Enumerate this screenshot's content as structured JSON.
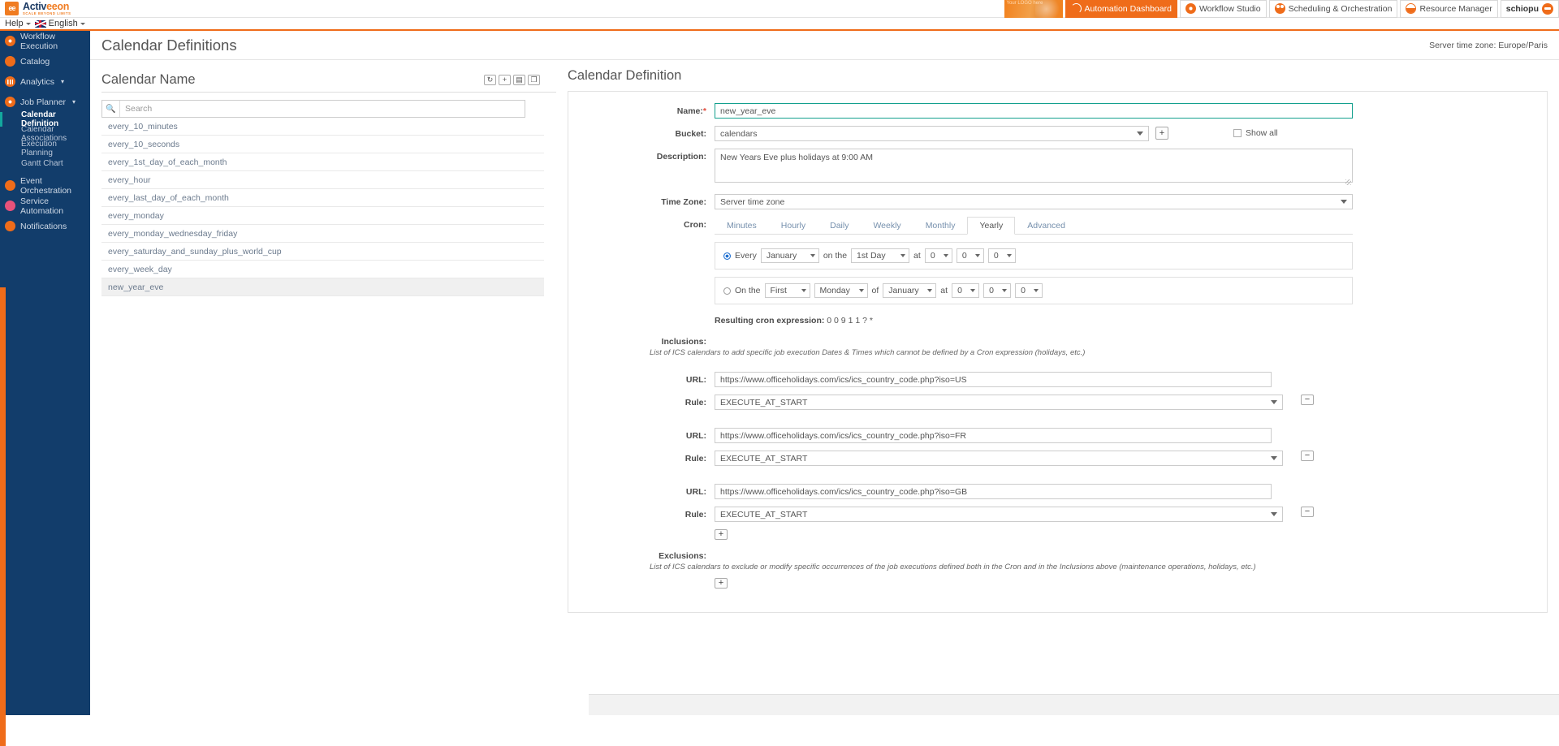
{
  "brand": {
    "name_part1": "Activ",
    "name_part2": "eeon",
    "tagline": "SCALE BEYOND LIMITS",
    "mark": "ee"
  },
  "topnav": {
    "logo_placeholder": "Your\nLOGO\nhere",
    "items": [
      {
        "label": "Automation Dashboard",
        "icon": "gauge-icon",
        "active": true
      },
      {
        "label": "Workflow Studio",
        "icon": "workflow-icon",
        "active": false
      },
      {
        "label": "Scheduling & Orchestration",
        "icon": "gears-icon",
        "active": false
      },
      {
        "label": "Resource Manager",
        "icon": "resource-icon",
        "active": false
      }
    ],
    "user": "schiopu"
  },
  "helpbar": {
    "help": "Help",
    "language": "English"
  },
  "sidebar": {
    "items": [
      {
        "label": "Workflow Execution",
        "icon": "play-circle-icon",
        "expandable": false
      },
      {
        "label": "Catalog",
        "icon": "catalog-icon",
        "expandable": false
      },
      {
        "label": "Analytics",
        "icon": "analytics-icon",
        "expandable": true
      },
      {
        "label": "Job Planner",
        "icon": "clock-icon",
        "expandable": true
      }
    ],
    "subitems": [
      {
        "label": "Calendar Definition",
        "active": true
      },
      {
        "label": "Calendar Associations",
        "active": false
      },
      {
        "label": "Execution Planning",
        "active": false
      },
      {
        "label": "Gantt Chart",
        "active": false
      }
    ],
    "items_after": [
      {
        "label": "Event Orchestration",
        "icon": "event-icon",
        "expandable": false
      },
      {
        "label": "Service Automation",
        "icon": "service-icon",
        "expandable": false
      },
      {
        "label": "Notifications",
        "icon": "bell-icon",
        "expandable": false
      }
    ]
  },
  "page": {
    "title": "Calendar Definitions",
    "server_timezone": "Server time zone: Europe/Paris"
  },
  "calendar_list": {
    "panel_title": "Calendar Name",
    "tools": [
      {
        "name": "refresh-icon",
        "glyph": "↻"
      },
      {
        "name": "add-icon",
        "glyph": "+"
      },
      {
        "name": "delete-icon",
        "glyph": "▤"
      },
      {
        "name": "duplicate-icon",
        "glyph": "❐"
      }
    ],
    "search_placeholder": "Search",
    "search_value": "",
    "items": [
      {
        "name": "every_10_minutes",
        "selected": false
      },
      {
        "name": "every_10_seconds",
        "selected": false
      },
      {
        "name": "every_1st_day_of_each_month",
        "selected": false
      },
      {
        "name": "every_hour",
        "selected": false
      },
      {
        "name": "every_last_day_of_each_month",
        "selected": false
      },
      {
        "name": "every_monday",
        "selected": false
      },
      {
        "name": "every_monday_wednesday_friday",
        "selected": false
      },
      {
        "name": "every_saturday_and_sunday_plus_world_cup",
        "selected": false
      },
      {
        "name": "every_week_day",
        "selected": false
      },
      {
        "name": "new_year_eve",
        "selected": true
      }
    ]
  },
  "definition": {
    "panel_title": "Calendar Definition",
    "name_label": "Name:",
    "name_value": "new_year_eve",
    "bucket_label": "Bucket:",
    "bucket_value": "calendars",
    "show_all_label": "Show all",
    "description_label": "Description:",
    "description_value": "New Years Eve plus holidays at 9:00 AM",
    "timezone_label": "Time Zone:",
    "timezone_value": "Server time zone",
    "cron_label": "Cron:",
    "tabs": [
      {
        "label": "Minutes",
        "active": false
      },
      {
        "label": "Hourly",
        "active": false
      },
      {
        "label": "Daily",
        "active": false
      },
      {
        "label": "Weekly",
        "active": false
      },
      {
        "label": "Monthly",
        "active": false
      },
      {
        "label": "Yearly",
        "active": true
      },
      {
        "label": "Advanced",
        "active": false
      }
    ],
    "row_every": {
      "selected": true,
      "prefix": "Every",
      "month": "January",
      "mid": "on the",
      "day": "1st Day",
      "at": "at",
      "hour": "0",
      "minute": "0",
      "second": "0"
    },
    "row_onthe": {
      "selected": false,
      "prefix": "On the",
      "ordinal": "First",
      "weekday": "Monday",
      "mid": "of",
      "month": "January",
      "at": "at",
      "hour": "0",
      "minute": "0",
      "second": "0"
    },
    "cron_expression_label": "Resulting cron expression:",
    "cron_expression_value": "0 0 9 1 1 ? *",
    "inclusions_label": "Inclusions:",
    "inclusions_desc": "List of ICS calendars to add specific job execution Dates & Times which cannot be defined by a Cron expression (holidays, etc.)",
    "url_label": "URL:",
    "rule_label": "Rule:",
    "inclusions": [
      {
        "url": "https://www.officeholidays.com/ics/ics_country_code.php?iso=US",
        "rule": "EXECUTE_AT_START"
      },
      {
        "url": "https://www.officeholidays.com/ics/ics_country_code.php?iso=FR",
        "rule": "EXECUTE_AT_START"
      },
      {
        "url": "https://www.officeholidays.com/ics/ics_country_code.php?iso=GB",
        "rule": "EXECUTE_AT_START"
      }
    ],
    "exclusions_label": "Exclusions:",
    "exclusions_desc": "List of ICS calendars to exclude or modify specific occurrences of the job executions defined both in the Cron and in the Inclusions above (maintenance operations, holidays, etc.)",
    "add_glyph": "+",
    "remove_glyph": "−"
  },
  "colors": {
    "brand_orange": "#ef6c1a",
    "sidebar_blue": "#123d6b",
    "focus_teal": "#13a08e",
    "required_red": "#e24a3b"
  }
}
